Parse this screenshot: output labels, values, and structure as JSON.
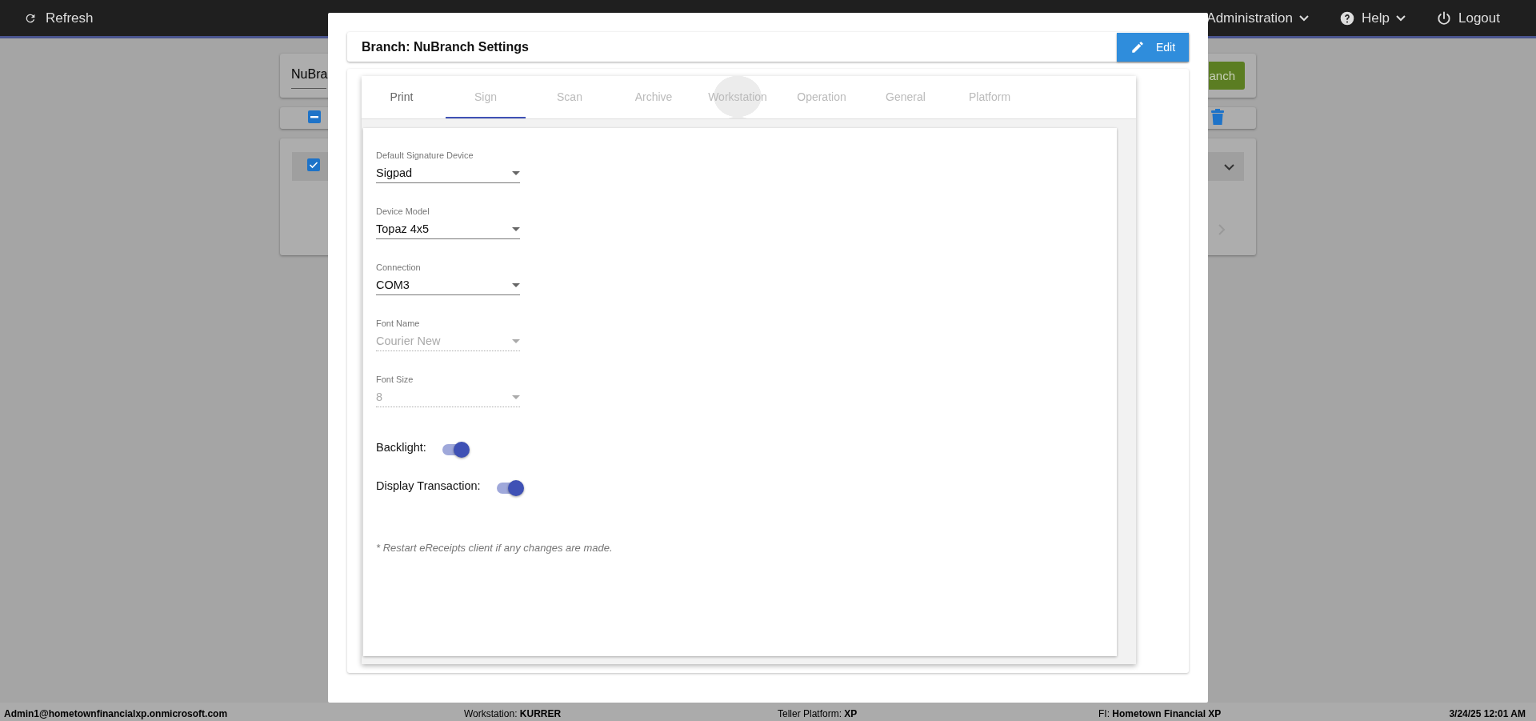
{
  "top_bar": {
    "refresh": "Refresh",
    "menus": [
      {
        "label": "Administration",
        "kind": "dropdown"
      },
      {
        "label": "Help",
        "kind": "help"
      },
      {
        "label": "Logout",
        "kind": "logout"
      }
    ]
  },
  "background": {
    "branch_field": "NuBra",
    "branch_button": "anch",
    "header_checkbox": {
      "indeterminate": true
    },
    "row": {
      "checked": true,
      "expanded": false
    }
  },
  "modal": {
    "title": "Branch: NuBranch Settings",
    "edit_button": "Edit",
    "tabs": [
      {
        "label": "Print",
        "selected": false,
        "disabled": false,
        "hovered": false
      },
      {
        "label": "Sign",
        "selected": true,
        "disabled": true,
        "hovered": false
      },
      {
        "label": "Scan",
        "selected": false,
        "disabled": true,
        "hovered": false
      },
      {
        "label": "Archive",
        "selected": false,
        "disabled": true,
        "hovered": false
      },
      {
        "label": "Workstation",
        "selected": false,
        "disabled": true,
        "hovered": true
      },
      {
        "label": "Operation",
        "selected": false,
        "disabled": true,
        "hovered": false
      },
      {
        "label": "General",
        "selected": false,
        "disabled": true,
        "hovered": false
      },
      {
        "label": "Platform",
        "selected": false,
        "disabled": true,
        "hovered": false
      }
    ],
    "fields": [
      {
        "label": "Default Signature Device",
        "value": "Sigpad",
        "disabled": false
      },
      {
        "label": "Device Model",
        "value": "Topaz 4x5",
        "disabled": false
      },
      {
        "label": "Connection",
        "value": "COM3",
        "disabled": false
      },
      {
        "label": "Font Name",
        "value": "Courier New",
        "disabled": true
      },
      {
        "label": "Font Size",
        "value": "8",
        "disabled": true
      }
    ],
    "toggles": [
      {
        "label": "Backlight:",
        "on": true
      },
      {
        "label": "Display Transaction:",
        "on": true
      }
    ],
    "note": "* Restart eReceipts client if any changes are made."
  },
  "status_bar": {
    "user": "Admin1@hometownfinancialxp.onmicrosoft.com",
    "workstation": "Workstation: **KURRER**",
    "platform": "Teller Platform: **XP**",
    "fi": "FI: **Hometown Financial XP**",
    "datetime": "3/24/25 12:01 AM"
  }
}
